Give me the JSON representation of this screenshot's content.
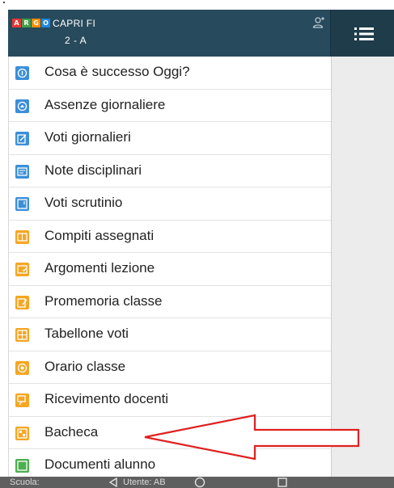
{
  "app": {
    "logo_letters": [
      "A",
      "R",
      "G",
      "O"
    ],
    "logo_colors": [
      "#e53935",
      "#43a047",
      "#fb8c00",
      "#1e88e5"
    ],
    "school_name": "CAPRI FI",
    "class_name": "2 - A"
  },
  "header": {
    "user_icon": "user-switch-icon",
    "menu_icon": "hamburger-icon"
  },
  "menu": {
    "items": [
      {
        "label": "Cosa è successo Oggi?",
        "icon": "info-icon",
        "color": "#3b8fd9"
      },
      {
        "label": "Assenze giornaliere",
        "icon": "absence-icon",
        "color": "#3b8fd9"
      },
      {
        "label": "Voti giornalieri",
        "icon": "grades-icon",
        "color": "#3b8fd9"
      },
      {
        "label": "Note disciplinari",
        "icon": "notes-icon",
        "color": "#3b8fd9"
      },
      {
        "label": "Voti scrutinio",
        "icon": "scrutiny-icon",
        "color": "#3b8fd9"
      },
      {
        "label": "Compiti assegnati",
        "icon": "homework-icon",
        "color": "#f5a623"
      },
      {
        "label": "Argomenti lezione",
        "icon": "lesson-topics-icon",
        "color": "#f5a623"
      },
      {
        "label": "Promemoria classe",
        "icon": "reminder-icon",
        "color": "#f5a623"
      },
      {
        "label": "Tabellone voti",
        "icon": "board-icon",
        "color": "#f5a623"
      },
      {
        "label": "Orario classe",
        "icon": "schedule-icon",
        "color": "#f5a623"
      },
      {
        "label": "Ricevimento docenti",
        "icon": "teacher-meeting-icon",
        "color": "#f5a623"
      },
      {
        "label": "Bacheca",
        "icon": "noticeboard-icon",
        "color": "#f5a623"
      },
      {
        "label": "Documenti alunno",
        "icon": "documents-icon",
        "color": "#4caf50"
      }
    ]
  },
  "bottom_bar": {
    "scuola_label": "Scuola:",
    "utente_label": "Utente:",
    "utente_value": "AB"
  },
  "colors": {
    "header_bg": "#274a5c",
    "arrow_stroke": "#e02020"
  }
}
